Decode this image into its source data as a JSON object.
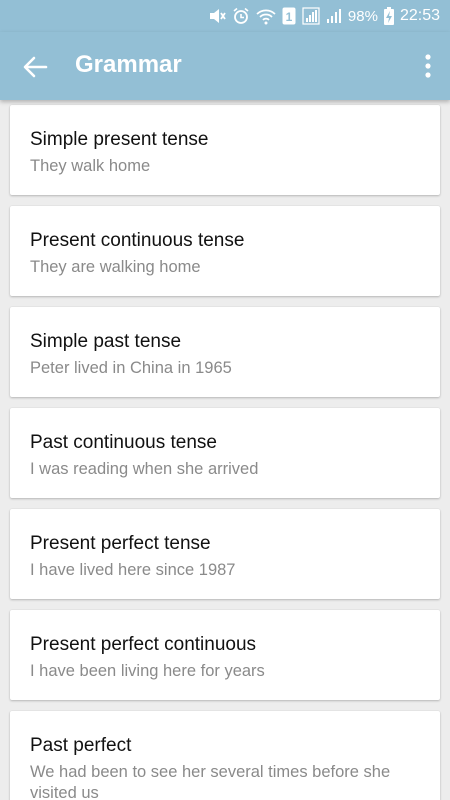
{
  "status_bar": {
    "battery": "98%",
    "time": "22:53",
    "icons": [
      "mute-icon",
      "alarm-icon",
      "wifi-icon",
      "sim-1-icon",
      "signal-sim1-icon",
      "signal-sim2-icon",
      "battery-charging-icon"
    ]
  },
  "app_bar": {
    "title": "Grammar",
    "back_icon": "arrow-back-icon",
    "menu_icon": "more-vert-icon"
  },
  "items": [
    {
      "title": "Simple present tense",
      "example": "They walk home"
    },
    {
      "title": "Present continuous tense",
      "example": "They are walking home"
    },
    {
      "title": "Simple past tense",
      "example": "Peter lived in China in 1965"
    },
    {
      "title": "Past continuous tense",
      "example": "I was reading when she arrived"
    },
    {
      "title": "Present perfect tense",
      "example": "I have lived here since 1987"
    },
    {
      "title": "Present perfect continuous",
      "example": "I have been living here for years"
    },
    {
      "title": "Past perfect",
      "example": "We had been to see her several times before she visited us"
    }
  ],
  "colors": {
    "app_bar": "#93bfd5",
    "background": "#ededed",
    "subtitle": "#8a8a8a"
  }
}
